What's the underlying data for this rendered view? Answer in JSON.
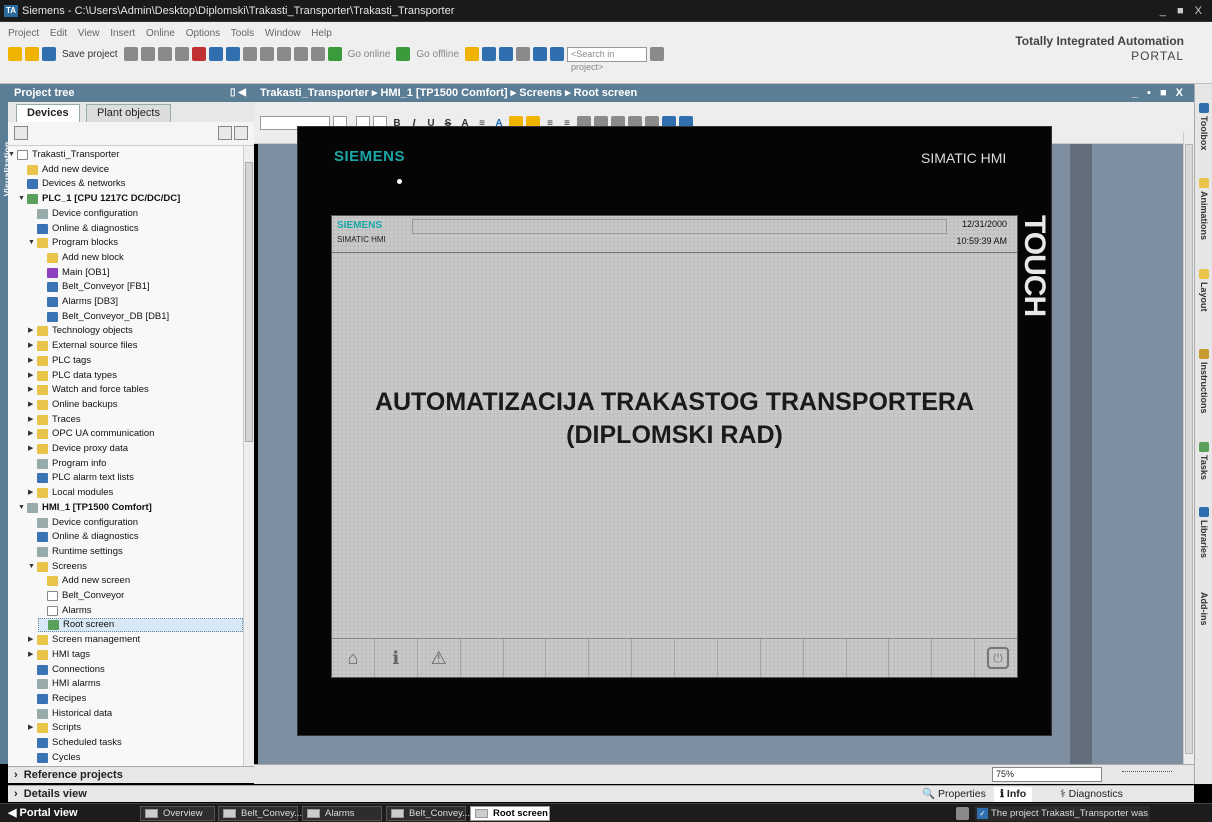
{
  "window": {
    "title": "Siemens - C:\\Users\\Admin\\Desktop\\Diplomski\\Trakasti_Transporter\\Trakasti_Transporter",
    "controls": "_ ■ X"
  },
  "menu": [
    "Project",
    "Edit",
    "View",
    "Insert",
    "Online",
    "Options",
    "Tools",
    "Window",
    "Help"
  ],
  "toolbar": {
    "save_project": "Save project",
    "go_online": "Go online",
    "go_offline": "Go offline",
    "search_placeholder": "<Search in project>"
  },
  "brand": {
    "line1": "Totally Integrated Automation",
    "line2": "PORTAL"
  },
  "project_tree": {
    "header": "Project tree",
    "side_label": "Visualization",
    "tabs": [
      "Devices",
      "Plant objects"
    ],
    "nodes": [
      {
        "label": "Trakasti_Transporter",
        "level": 0,
        "arrow": "▼",
        "icon": "wht"
      },
      {
        "label": "Add new device",
        "level": 1,
        "arrow": "",
        "icon": "yel"
      },
      {
        "label": "Devices & networks",
        "level": 1,
        "arrow": "",
        "icon": "blue"
      },
      {
        "label": "PLC_1 [CPU 1217C DC/DC/DC]",
        "level": 1,
        "arrow": "▼",
        "icon": "grn",
        "bold": true
      },
      {
        "label": "Device configuration",
        "level": 2,
        "arrow": "",
        "icon": "gry"
      },
      {
        "label": "Online & diagnostics",
        "level": 2,
        "arrow": "",
        "icon": "blue"
      },
      {
        "label": "Program blocks",
        "level": 2,
        "arrow": "▼",
        "icon": "yel"
      },
      {
        "label": "Add new block",
        "level": 3,
        "arrow": "",
        "icon": "yel"
      },
      {
        "label": "Main [OB1]",
        "level": 3,
        "arrow": "",
        "icon": "pur"
      },
      {
        "label": "Belt_Conveyor [FB1]",
        "level": 3,
        "arrow": "",
        "icon": "blue"
      },
      {
        "label": "Alarms [DB3]",
        "level": 3,
        "arrow": "",
        "icon": "blue"
      },
      {
        "label": "Belt_Conveyor_DB [DB1]",
        "level": 3,
        "arrow": "",
        "icon": "blue"
      },
      {
        "label": "Technology objects",
        "level": 2,
        "arrow": "▶",
        "icon": "yel"
      },
      {
        "label": "External source files",
        "level": 2,
        "arrow": "▶",
        "icon": "yel"
      },
      {
        "label": "PLC tags",
        "level": 2,
        "arrow": "▶",
        "icon": "yel"
      },
      {
        "label": "PLC data types",
        "level": 2,
        "arrow": "▶",
        "icon": "yel"
      },
      {
        "label": "Watch and force tables",
        "level": 2,
        "arrow": "▶",
        "icon": "yel"
      },
      {
        "label": "Online backups",
        "level": 2,
        "arrow": "▶",
        "icon": "yel"
      },
      {
        "label": "Traces",
        "level": 2,
        "arrow": "▶",
        "icon": "yel"
      },
      {
        "label": "OPC UA communication",
        "level": 2,
        "arrow": "▶",
        "icon": "yel"
      },
      {
        "label": "Device proxy data",
        "level": 2,
        "arrow": "▶",
        "icon": "yel"
      },
      {
        "label": "Program info",
        "level": 2,
        "arrow": "",
        "icon": "gry"
      },
      {
        "label": "PLC alarm text lists",
        "level": 2,
        "arrow": "",
        "icon": "blue"
      },
      {
        "label": "Local modules",
        "level": 2,
        "arrow": "▶",
        "icon": "yel"
      },
      {
        "label": "HMI_1 [TP1500 Comfort]",
        "level": 1,
        "arrow": "▼",
        "icon": "gry",
        "bold": true
      },
      {
        "label": "Device configuration",
        "level": 2,
        "arrow": "",
        "icon": "gry"
      },
      {
        "label": "Online & diagnostics",
        "level": 2,
        "arrow": "",
        "icon": "blue"
      },
      {
        "label": "Runtime settings",
        "level": 2,
        "arrow": "",
        "icon": "gry"
      },
      {
        "label": "Screens",
        "level": 2,
        "arrow": "▼",
        "icon": "yel"
      },
      {
        "label": "Add new screen",
        "level": 3,
        "arrow": "",
        "icon": "yel"
      },
      {
        "label": "Belt_Conveyor",
        "level": 3,
        "arrow": "",
        "icon": "wht"
      },
      {
        "label": "Alarms",
        "level": 3,
        "arrow": "",
        "icon": "wht"
      },
      {
        "label": "Root screen",
        "level": 3,
        "arrow": "",
        "icon": "grn",
        "selected": true
      },
      {
        "label": "Screen management",
        "level": 2,
        "arrow": "▶",
        "icon": "yel"
      },
      {
        "label": "HMI tags",
        "level": 2,
        "arrow": "▶",
        "icon": "yel"
      },
      {
        "label": "Connections",
        "level": 2,
        "arrow": "",
        "icon": "blue"
      },
      {
        "label": "HMI alarms",
        "level": 2,
        "arrow": "",
        "icon": "gry"
      },
      {
        "label": "Recipes",
        "level": 2,
        "arrow": "",
        "icon": "blue"
      },
      {
        "label": "Historical data",
        "level": 2,
        "arrow": "",
        "icon": "gry"
      },
      {
        "label": "Scripts",
        "level": 2,
        "arrow": "▶",
        "icon": "yel"
      },
      {
        "label": "Scheduled tasks",
        "level": 2,
        "arrow": "",
        "icon": "blue"
      },
      {
        "label": "Cycles",
        "level": 2,
        "arrow": "",
        "icon": "blue"
      }
    ],
    "reference_projects": "Reference projects",
    "details_view": "Details view"
  },
  "editor": {
    "breadcrumb": "Trakasti_Transporter ▸ HMI_1 [TP1500 Comfort] ▸ Screens ▸ Root screen",
    "controls": "_ ▪ ■ X",
    "format_buttons": [
      "B",
      "I",
      "U",
      "S",
      "A",
      "≡",
      "A",
      "≡",
      "≡"
    ]
  },
  "device": {
    "brand": "SIEMENS",
    "model": "SIMATIC HMI",
    "touch": "TOUCH",
    "screen": {
      "brand": "SIEMENS",
      "model": "SIMATIC HMI",
      "date": "12/31/2000",
      "time": "10:59:39 AM",
      "title_line1": "AUTOMATIZACIJA TRAKASTOG TRANSPORTERA",
      "title_line2": "(DIPLOMSKI RAD)"
    }
  },
  "right_tabs": [
    "Toolbox",
    "Animations",
    "Layout",
    "Instructions",
    "Tasks",
    "Libraries",
    "Add-ins"
  ],
  "bottom": {
    "zoom": "75%",
    "properties": "Properties",
    "info": "Info",
    "diagnostics": "Diagnostics"
  },
  "taskbar": {
    "portal_view": "◀  Portal view",
    "tasks": [
      "Overview",
      "Belt_Convey...",
      "Alarms",
      "Belt_Convey...",
      "Root screen"
    ],
    "status_message": "The project Trakasti_Transporter was sa..."
  }
}
